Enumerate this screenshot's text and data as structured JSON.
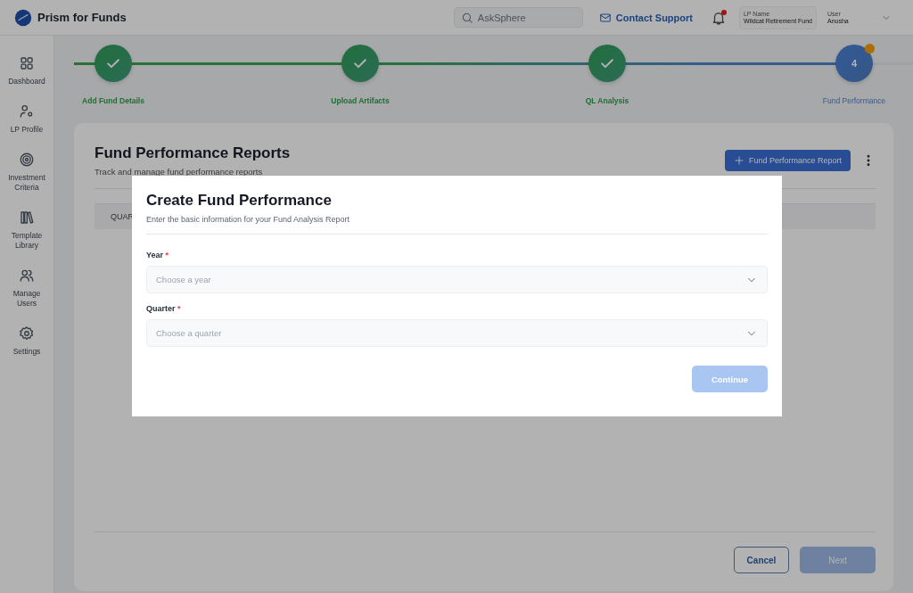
{
  "header": {
    "app_name": "Prism for Funds",
    "search": {
      "placeholder": "AskSphere"
    },
    "contact_link": "Contact Support",
    "notifications": {
      "unread": true
    },
    "lp_name": {
      "label": "LP Name",
      "value": "Wildcat Retirement Fund"
    },
    "user": {
      "label": "User",
      "value": "Anusha"
    }
  },
  "sidebar": {
    "items": [
      {
        "label": "Dashboard"
      },
      {
        "label": "LP Profile"
      },
      {
        "label": "Investment Criteria"
      },
      {
        "label": "Template Library"
      },
      {
        "label": "Manage Users"
      },
      {
        "label": "Settings"
      }
    ]
  },
  "stepper": {
    "steps": [
      {
        "label": "Add Fund Details",
        "kind": "done"
      },
      {
        "label": "Upload Artifacts",
        "kind": "done"
      },
      {
        "label": "QL Analysis",
        "kind": "done"
      },
      {
        "label": "Fund Performance",
        "kind": "current",
        "number": "4",
        "badge": true
      }
    ]
  },
  "card": {
    "title": "Fund Performance Reports",
    "subtitle": "Track and manage fund performance reports",
    "add_button": "Fund Performance Report",
    "table": {
      "columns": [
        "QUAR"
      ]
    },
    "buttons": {
      "cancel": "Cancel",
      "next": {
        "label": "Next",
        "disabled": true
      }
    }
  },
  "modal": {
    "title": "Create Fund Performance",
    "subtitle": "Enter the basic information for your Fund Analysis Report",
    "fields": [
      {
        "label": "Year",
        "required_mark": "*",
        "placeholder": "Choose a year"
      },
      {
        "label": "Quarter",
        "required_mark": "*",
        "placeholder": "Choose a quarter"
      }
    ],
    "continue_button": {
      "label": "Continue",
      "disabled": true
    }
  }
}
